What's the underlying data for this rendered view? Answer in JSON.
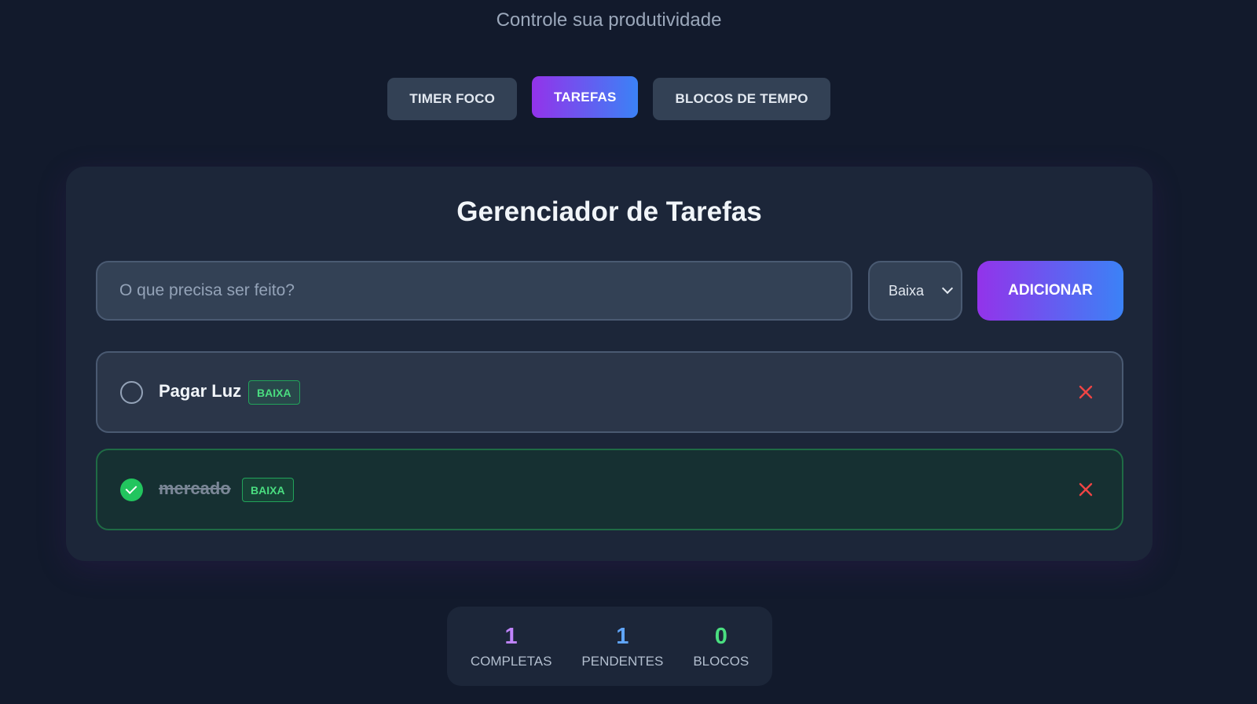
{
  "header": {
    "subtitle": "Controle sua produtividade"
  },
  "tabs": [
    {
      "label": "TIMER FOCO",
      "active": false
    },
    {
      "label": "TAREFAS",
      "active": true
    },
    {
      "label": "BLOCOS DE TEMPO",
      "active": false
    }
  ],
  "task_manager": {
    "title": "Gerenciador de Tarefas",
    "input": {
      "value": "",
      "placeholder": "O que precisa ser feito?"
    },
    "priority_select": {
      "selected": "Baixa"
    },
    "add_button_label": "ADICIONAR"
  },
  "tasks": [
    {
      "text": "Pagar Luz",
      "priority": "BAIXA",
      "completed": false
    },
    {
      "text": "mercado",
      "priority": "BAIXA",
      "completed": true
    }
  ],
  "stats": [
    {
      "value": "1",
      "label": "COMPLETAS",
      "color": "#c084fc"
    },
    {
      "value": "1",
      "label": "PENDENTES",
      "color": "#60a5fa"
    },
    {
      "value": "0",
      "label": "BLOCOS",
      "color": "#4ade80"
    }
  ],
  "colors": {
    "background": "#121a2c",
    "card": "#1c2639",
    "accent_gradient_start": "#9333ea",
    "accent_gradient_end": "#3b82f6",
    "delete": "#ef4444",
    "done_green": "#22c55e"
  }
}
